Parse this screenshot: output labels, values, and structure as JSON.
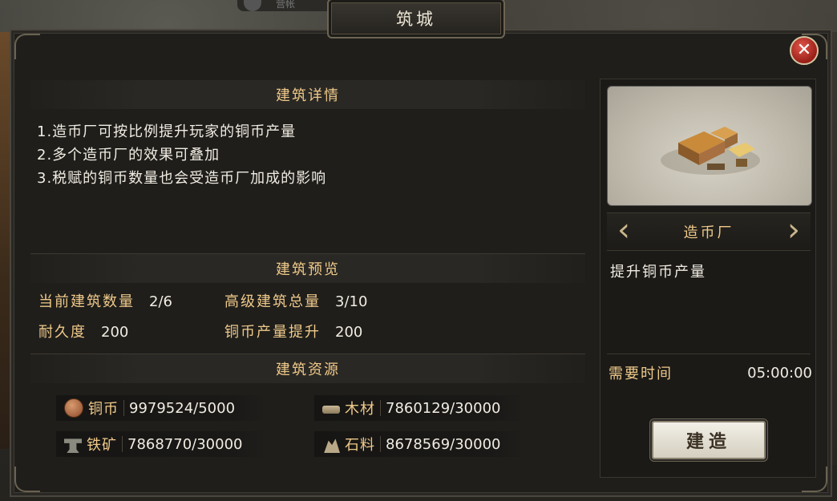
{
  "top_tab": {
    "label": "营帐"
  },
  "dialog": {
    "title": "筑城",
    "close_label": "✕"
  },
  "details": {
    "title": "建筑详情",
    "lines": [
      "1.造币厂可按比例提升玩家的铜币产量",
      "2.多个造币厂的效果可叠加",
      "3.税赋的铜币数量也会受造币厂加成的影响"
    ]
  },
  "preview_section": {
    "title": "建筑预览",
    "stats": [
      {
        "label": "当前建筑数量",
        "value": "2/6"
      },
      {
        "label": "高级建筑总量",
        "value": "3/10"
      },
      {
        "label": "耐久度",
        "value": "200"
      },
      {
        "label": "铜币产量提升",
        "value": "200"
      }
    ]
  },
  "resources_section": {
    "title": "建筑资源",
    "items": [
      {
        "name": "铜币",
        "value": "9979524/5000",
        "icon": "copper-coin-icon"
      },
      {
        "name": "木材",
        "value": "7860129/30000",
        "icon": "wood-icon"
      },
      {
        "name": "铁矿",
        "value": "7868770/30000",
        "icon": "iron-anvil-icon"
      },
      {
        "name": "石料",
        "value": "8678569/30000",
        "icon": "stone-icon"
      }
    ]
  },
  "building": {
    "name": "造币厂",
    "description": "提升铜币产量",
    "prev_arrow": "‹",
    "next_arrow": "›",
    "time_label": "需要时间",
    "time_value": "05:00:00",
    "build_button": "建造"
  },
  "colors": {
    "gold_text": "#efc98a",
    "white_text": "#f0ece2",
    "close_red": "#c0332a"
  }
}
